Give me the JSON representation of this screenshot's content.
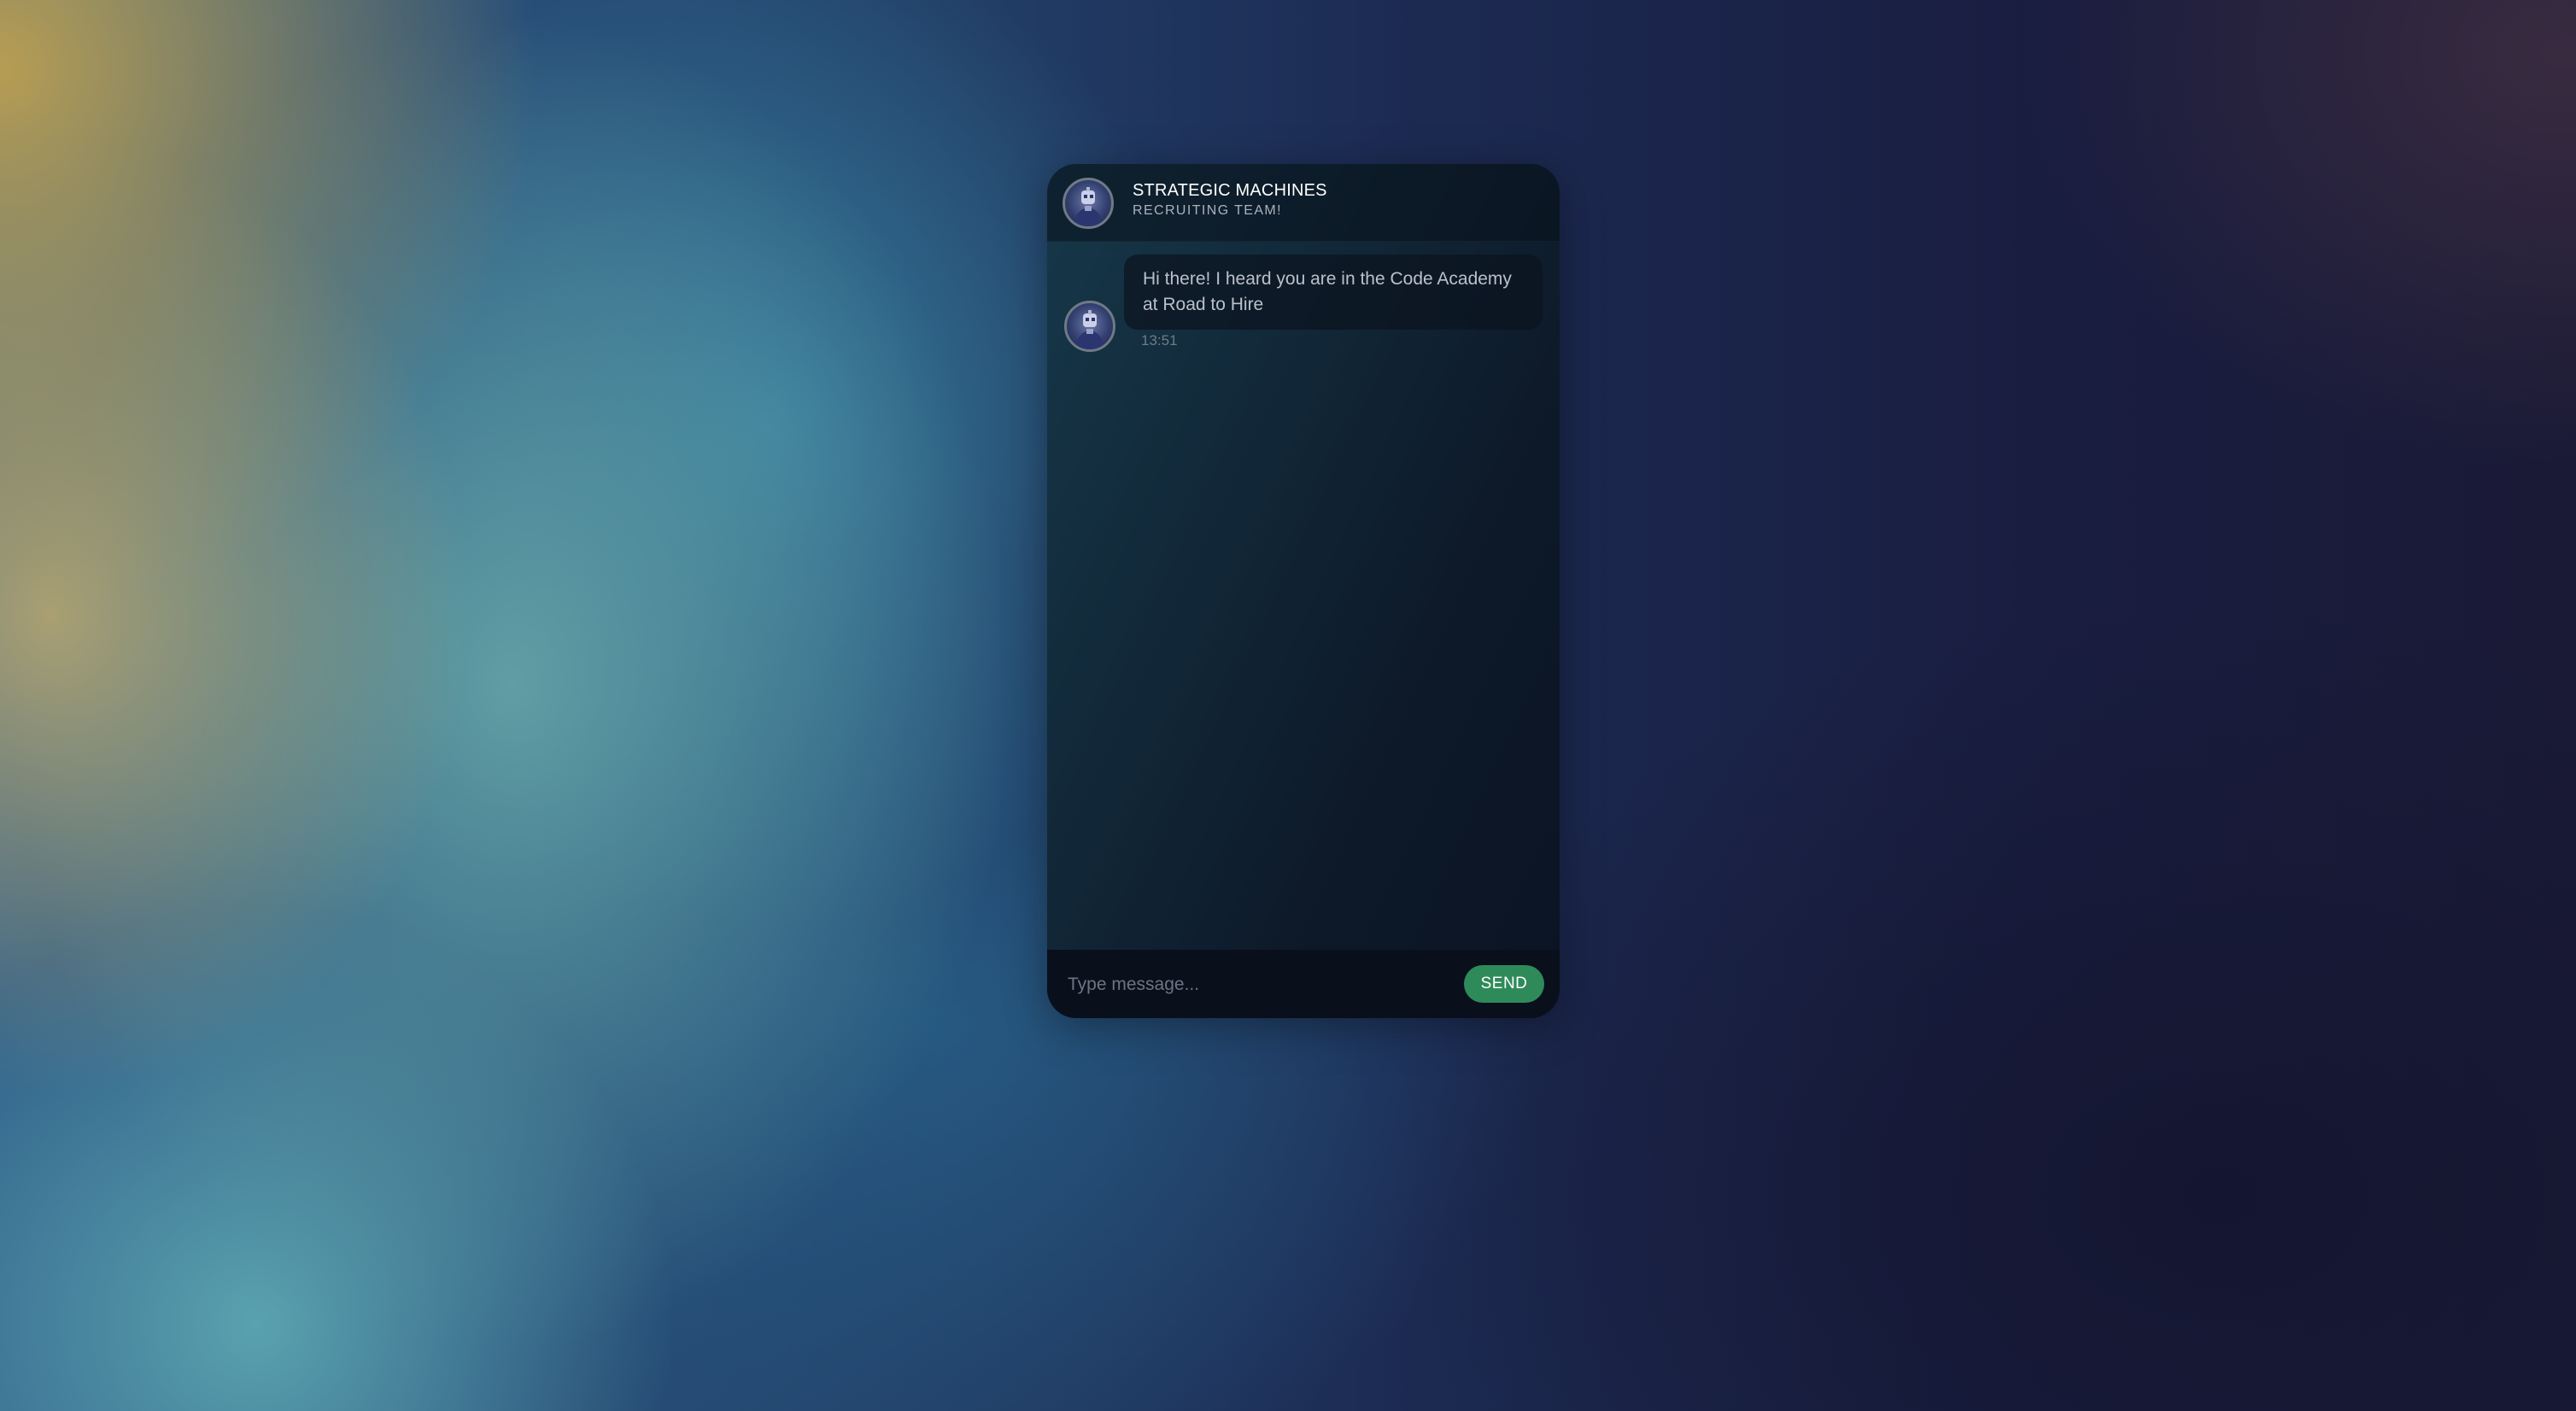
{
  "chat": {
    "header": {
      "title": "STRATEGIC MACHINES",
      "subtitle": "RECRUITING TEAM!",
      "avatar_icon": "robot-avatar-icon"
    },
    "messages": [
      {
        "sender": "bot",
        "avatar_icon": "robot-avatar-icon",
        "text": "Hi there! I heard you are in the Code Academy at Road to Hire",
        "time": "13:51"
      }
    ],
    "composer": {
      "placeholder": "Type message...",
      "value": "",
      "send_label": "SEND"
    }
  },
  "colors": {
    "send_button": "#2f8a5a",
    "panel": "#0d1828",
    "title_text": "#ffffff"
  }
}
